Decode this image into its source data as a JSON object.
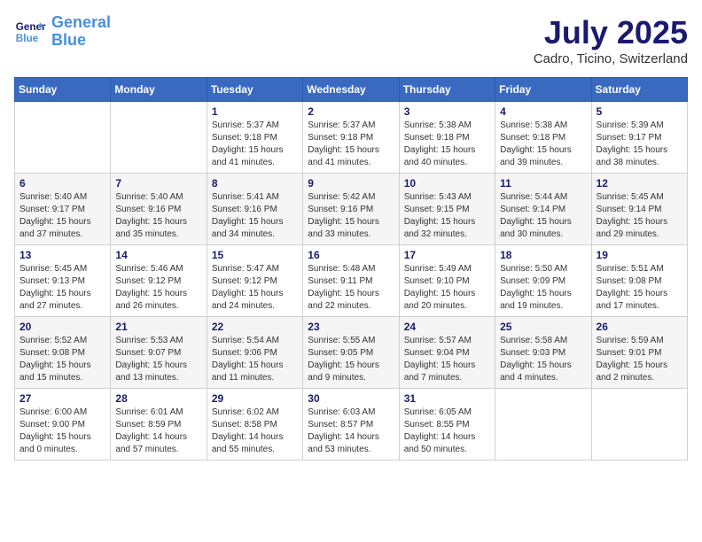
{
  "header": {
    "logo_line1": "General",
    "logo_line2": "Blue",
    "month_year": "July 2025",
    "location": "Cadro, Ticino, Switzerland"
  },
  "weekdays": [
    "Sunday",
    "Monday",
    "Tuesday",
    "Wednesday",
    "Thursday",
    "Friday",
    "Saturday"
  ],
  "weeks": [
    [
      null,
      null,
      {
        "day": "1",
        "sunrise": "5:37 AM",
        "sunset": "9:18 PM",
        "daylight": "15 hours and 41 minutes."
      },
      {
        "day": "2",
        "sunrise": "5:37 AM",
        "sunset": "9:18 PM",
        "daylight": "15 hours and 41 minutes."
      },
      {
        "day": "3",
        "sunrise": "5:38 AM",
        "sunset": "9:18 PM",
        "daylight": "15 hours and 40 minutes."
      },
      {
        "day": "4",
        "sunrise": "5:38 AM",
        "sunset": "9:18 PM",
        "daylight": "15 hours and 39 minutes."
      },
      {
        "day": "5",
        "sunrise": "5:39 AM",
        "sunset": "9:17 PM",
        "daylight": "15 hours and 38 minutes."
      }
    ],
    [
      {
        "day": "6",
        "sunrise": "5:40 AM",
        "sunset": "9:17 PM",
        "daylight": "15 hours and 37 minutes."
      },
      {
        "day": "7",
        "sunrise": "5:40 AM",
        "sunset": "9:16 PM",
        "daylight": "15 hours and 35 minutes."
      },
      {
        "day": "8",
        "sunrise": "5:41 AM",
        "sunset": "9:16 PM",
        "daylight": "15 hours and 34 minutes."
      },
      {
        "day": "9",
        "sunrise": "5:42 AM",
        "sunset": "9:16 PM",
        "daylight": "15 hours and 33 minutes."
      },
      {
        "day": "10",
        "sunrise": "5:43 AM",
        "sunset": "9:15 PM",
        "daylight": "15 hours and 32 minutes."
      },
      {
        "day": "11",
        "sunrise": "5:44 AM",
        "sunset": "9:14 PM",
        "daylight": "15 hours and 30 minutes."
      },
      {
        "day": "12",
        "sunrise": "5:45 AM",
        "sunset": "9:14 PM",
        "daylight": "15 hours and 29 minutes."
      }
    ],
    [
      {
        "day": "13",
        "sunrise": "5:45 AM",
        "sunset": "9:13 PM",
        "daylight": "15 hours and 27 minutes."
      },
      {
        "day": "14",
        "sunrise": "5:46 AM",
        "sunset": "9:12 PM",
        "daylight": "15 hours and 26 minutes."
      },
      {
        "day": "15",
        "sunrise": "5:47 AM",
        "sunset": "9:12 PM",
        "daylight": "15 hours and 24 minutes."
      },
      {
        "day": "16",
        "sunrise": "5:48 AM",
        "sunset": "9:11 PM",
        "daylight": "15 hours and 22 minutes."
      },
      {
        "day": "17",
        "sunrise": "5:49 AM",
        "sunset": "9:10 PM",
        "daylight": "15 hours and 20 minutes."
      },
      {
        "day": "18",
        "sunrise": "5:50 AM",
        "sunset": "9:09 PM",
        "daylight": "15 hours and 19 minutes."
      },
      {
        "day": "19",
        "sunrise": "5:51 AM",
        "sunset": "9:08 PM",
        "daylight": "15 hours and 17 minutes."
      }
    ],
    [
      {
        "day": "20",
        "sunrise": "5:52 AM",
        "sunset": "9:08 PM",
        "daylight": "15 hours and 15 minutes."
      },
      {
        "day": "21",
        "sunrise": "5:53 AM",
        "sunset": "9:07 PM",
        "daylight": "15 hours and 13 minutes."
      },
      {
        "day": "22",
        "sunrise": "5:54 AM",
        "sunset": "9:06 PM",
        "daylight": "15 hours and 11 minutes."
      },
      {
        "day": "23",
        "sunrise": "5:55 AM",
        "sunset": "9:05 PM",
        "daylight": "15 hours and 9 minutes."
      },
      {
        "day": "24",
        "sunrise": "5:57 AM",
        "sunset": "9:04 PM",
        "daylight": "15 hours and 7 minutes."
      },
      {
        "day": "25",
        "sunrise": "5:58 AM",
        "sunset": "9:03 PM",
        "daylight": "15 hours and 4 minutes."
      },
      {
        "day": "26",
        "sunrise": "5:59 AM",
        "sunset": "9:01 PM",
        "daylight": "15 hours and 2 minutes."
      }
    ],
    [
      {
        "day": "27",
        "sunrise": "6:00 AM",
        "sunset": "9:00 PM",
        "daylight": "15 hours and 0 minutes."
      },
      {
        "day": "28",
        "sunrise": "6:01 AM",
        "sunset": "8:59 PM",
        "daylight": "14 hours and 57 minutes."
      },
      {
        "day": "29",
        "sunrise": "6:02 AM",
        "sunset": "8:58 PM",
        "daylight": "14 hours and 55 minutes."
      },
      {
        "day": "30",
        "sunrise": "6:03 AM",
        "sunset": "8:57 PM",
        "daylight": "14 hours and 53 minutes."
      },
      {
        "day": "31",
        "sunrise": "6:05 AM",
        "sunset": "8:55 PM",
        "daylight": "14 hours and 50 minutes."
      },
      null,
      null
    ]
  ]
}
